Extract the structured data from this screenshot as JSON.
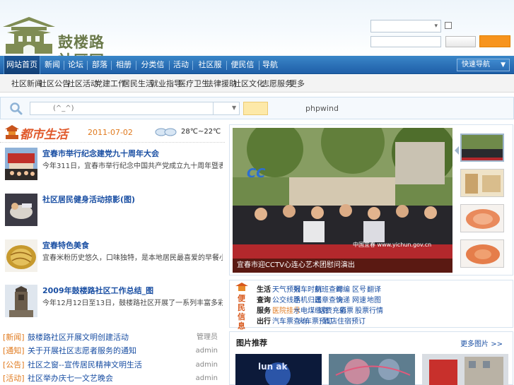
{
  "header": {
    "logo_title_line1": "鼓楼路",
    "logo_title_line2": "社区网"
  },
  "nav": {
    "items": [
      "网站首页",
      "新闻",
      "论坛",
      "部落",
      "相册",
      "分类信息",
      "活动",
      "社区服务",
      "便民信息",
      "导航"
    ],
    "active_index": 0,
    "dropdown_label": "快速导航"
  },
  "subnav": {
    "items": [
      "社区新闻",
      "社区公告",
      "社区活动",
      "党建工作",
      "居民生活",
      "就业指导",
      "医疗卫生",
      "法律援助",
      "社区文化",
      "志愿服务",
      "更多"
    ]
  },
  "search": {
    "placeholder": "(^_^)",
    "hint": "phpwind"
  },
  "city": {
    "title": "都市生活",
    "date": "2011-07-02",
    "weather_icon": "cloud-icon",
    "temperature": "28℃~22℃"
  },
  "news": [
    {
      "title": "宜春市举行纪念建党九十周年大会",
      "desc": "今年311日，宜春市举行纪念中国共产党成立九十周年暨表彰先进基层党组织大会"
    },
    {
      "title": "社区居民健身活动掠影(图)",
      "desc": ""
    },
    {
      "title": "宜春特色美食",
      "desc": "宜春米粉历史悠久，口味独特，是本地居民最喜爱的早餐小吃之一，深受欢迎"
    },
    {
      "title": "2009年鼓楼路社区工作总结_图",
      "desc": "今年12月12日至13日，鼓楼路社区开展了一系列丰富多彩的活动“社区文化节”"
    }
  ],
  "list": [
    {
      "tag": "[新闻]",
      "title": "鼓楼路社区开展文明创建活动",
      "author": "管理员"
    },
    {
      "tag": "[通知]",
      "title": "关于开展社区志愿者服务的通知",
      "author": "admin"
    },
    {
      "tag": "[公告]",
      "title": "社区之窗--宣传居民精神文明生活",
      "author": "admin"
    },
    {
      "tag": "[活动]",
      "title": "社区举办庆七一文艺晚会",
      "author": "admin"
    }
  ],
  "slider": {
    "caption": "宜春市迎CCTV心连心艺术团慰问演出",
    "watermark": "中国宜春 www.yichun.gov.cn",
    "active_thumb": 0
  },
  "service": {
    "logo_text": "便民信息",
    "rows": [
      {
        "cat": "生活",
        "links": [
          "天气预报",
          "列车时刻",
          "航班查询",
          "邮编",
          "区号",
          "翻译"
        ]
      },
      {
        "cat": "查询",
        "links": [
          "公交线路",
          "手机归属",
          "违章查询",
          "快递",
          "网速",
          "地图"
        ]
      },
      {
        "cat": "服务",
        "links": [
          "医院挂号",
          "水电煤缴费",
          "话费充值",
          "彩票",
          "股票行情"
        ]
      },
      {
        "cat": "出行",
        "links": [
          "汽车票查询",
          "火车票预订",
          "酒店住宿预订"
        ]
      }
    ],
    "hot_link": {
      "row": 2,
      "index": 0
    }
  },
  "recommend": {
    "title": "图片推荐",
    "more": "更多图片 >>"
  },
  "colors": {
    "nav_blue": "#1f5fa8",
    "link_blue": "#1a4fa3",
    "accent_orange": "#e07a1e"
  }
}
